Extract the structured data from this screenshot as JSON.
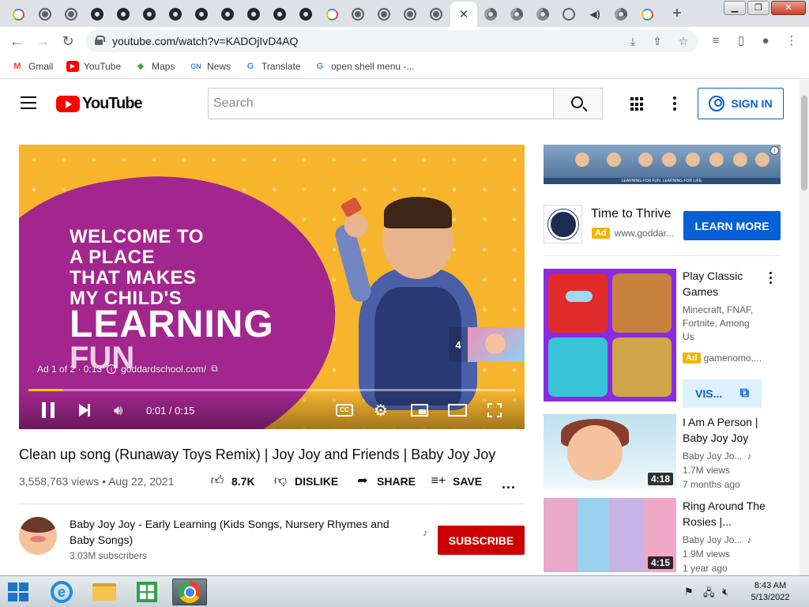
{
  "browser": {
    "url": "youtube.com/watch?v=KADOjIvD4AQ",
    "tab_count_visible": 26,
    "bookmarks": [
      {
        "label": "Gmail",
        "icon": "gmail-icon"
      },
      {
        "label": "YouTube",
        "icon": "youtube-icon"
      },
      {
        "label": "Maps",
        "icon": "maps-icon"
      },
      {
        "label": "News",
        "icon": "news-icon"
      },
      {
        "label": "Translate",
        "icon": "translate-icon"
      },
      {
        "label": "open shell menu -...",
        "icon": "google-icon"
      }
    ]
  },
  "header": {
    "logo_text": "YouTube",
    "search_placeholder": "Search",
    "signin_label": "SIGN IN"
  },
  "player": {
    "ad_line1": "WELCOME TO",
    "ad_line2": "A PLACE",
    "ad_line3": "THAT MAKES",
    "ad_line4": "MY CHILD'S",
    "ad_big": "LEARNING",
    "ad_big2": "FUN",
    "ad_counter": "Ad 1 of 2 · 0:13",
    "ad_domain": "goddardschool.com/",
    "skip_count": "4",
    "time": "0:01 / 0:15",
    "progress": 0.07,
    "cc_label": "CC"
  },
  "video": {
    "title": "Clean up song (Runaway Toys Remix) | Joy Joy and Friends | Baby Joy Joy",
    "views_date": "3,558,763 views • Aug 22, 2021",
    "like_count": "8.7K",
    "dislike_label": "DISLIKE",
    "share_label": "SHARE",
    "save_label": "SAVE",
    "more": "..."
  },
  "channel": {
    "name": "Baby Joy Joy - Early Learning (Kids Songs, Nursery Rhymes and Baby Songs)",
    "subscribers": "3.03M subscribers",
    "subscribe_label": "SUBSCRIBE"
  },
  "sidebar": {
    "banner_text": "LEARNING FOR FUN. LEARNING FOR LIFE.",
    "ad1": {
      "title": "Time to Thrive",
      "badge": "Ad",
      "domain": "www.goddar...",
      "cta": "LEARN MORE"
    },
    "ad2": {
      "title": "Play Classic Games",
      "desc": "Minecraft, FNAF, Fortnite, Among Us",
      "badge": "Ad",
      "domain": "gamenomo....",
      "cta": "VIS..."
    },
    "recs": [
      {
        "title": "I Am A Person | Baby Joy Joy",
        "channel": "Baby Joy Jo...",
        "views": "1.7M views",
        "age": "7 months ago",
        "duration": "4:18"
      },
      {
        "title": "Ring Around The Rosies |...",
        "channel": "Baby Joy Jo...",
        "views": "1.9M views",
        "age": "1 year ago",
        "duration": "4:15"
      }
    ]
  },
  "taskbar": {
    "time": "8:43 AM",
    "date": "5/13/2022"
  }
}
